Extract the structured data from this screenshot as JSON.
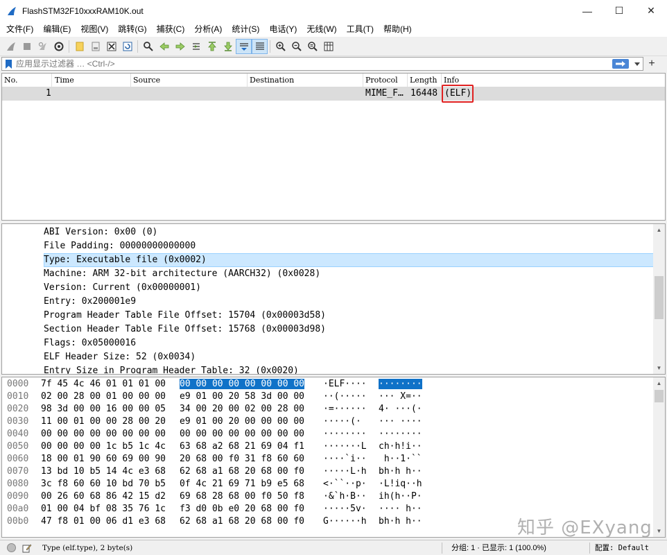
{
  "window": {
    "title": "FlashSTM32F10xxxRAM10K.out",
    "minimize": "—",
    "maximize": "☐",
    "close": "✕"
  },
  "menu": [
    "文件(F)",
    "编辑(E)",
    "视图(V)",
    "跳转(G)",
    "捕获(C)",
    "分析(A)",
    "统计(S)",
    "电话(Y)",
    "无线(W)",
    "工具(T)",
    "帮助(H)"
  ],
  "filter": {
    "placeholder": "应用显示过滤器 … <Ctrl-/>"
  },
  "packet_list": {
    "columns": [
      "No.",
      "Time",
      "Source",
      "Destination",
      "Protocol",
      "Length",
      "Info"
    ],
    "rows": [
      {
        "no": "1",
        "time": "",
        "source": "",
        "destination": "",
        "protocol": "MIME_F…",
        "length": "16448",
        "info": "(ELF)"
      }
    ]
  },
  "details": {
    "lines": [
      "ABI Version: 0x00 (0)",
      "File Padding: 00000000000000",
      "Type: Executable file (0x0002)",
      "Machine: ARM 32-bit architecture (AARCH32) (0x0028)",
      "Version: Current (0x00000001)",
      "Entry: 0x200001e9",
      "Program Header Table File Offset: 15704 (0x00003d58)",
      "Section Header Table File Offset: 15768 (0x00003d98)",
      "Flags: 0x05000016",
      "ELF Header Size: 52 (0x0034)",
      "Entry Size in Program Header Table: 32 (0x0020)"
    ],
    "selected_index": 2
  },
  "bytes": {
    "rows": [
      {
        "offset": "0000",
        "hex1": "7f 45 4c 46 01 01 01 00",
        "hex2": "00 00 00 00 00 00 00 00",
        "ascii1": "·ELF····",
        "ascii2": "········"
      },
      {
        "offset": "0010",
        "hex1": "02 00 28 00 01 00 00 00",
        "hex2": "e9 01 00 20 58 3d 00 00",
        "ascii1": "··(·····",
        "ascii2": "··· X=··"
      },
      {
        "offset": "0020",
        "hex1": "98 3d 00 00 16 00 00 05",
        "hex2": "34 00 20 00 02 00 28 00",
        "ascii1": "·=······",
        "ascii2": "4· ···(·"
      },
      {
        "offset": "0030",
        "hex1": "11 00 01 00 00 28 00 20",
        "hex2": "e9 01 00 20 00 00 00 00",
        "ascii1": "·····(· ",
        "ascii2": "··· ····"
      },
      {
        "offset": "0040",
        "hex1": "00 00 00 00 00 00 00 00",
        "hex2": "00 00 00 00 00 00 00 00",
        "ascii1": "········",
        "ascii2": "········"
      },
      {
        "offset": "0050",
        "hex1": "00 00 00 00 1c b5 1c 4c",
        "hex2": "63 68 a2 68 21 69 04 f1",
        "ascii1": "·······L",
        "ascii2": "ch·h!i··"
      },
      {
        "offset": "0060",
        "hex1": "18 00 01 90 60 69 00 90",
        "hex2": "20 68 00 f0 31 f8 60 60",
        "ascii1": "····`i··",
        "ascii2": " h··1·``"
      },
      {
        "offset": "0070",
        "hex1": "13 bd 10 b5 14 4c e3 68",
        "hex2": "62 68 a1 68 20 68 00 f0",
        "ascii1": "·····L·h",
        "ascii2": "bh·h h··"
      },
      {
        "offset": "0080",
        "hex1": "3c f8 60 60 10 bd 70 b5",
        "hex2": "0f 4c 21 69 71 b9 e5 68",
        "ascii1": "<·``··p·",
        "ascii2": "·L!iq··h"
      },
      {
        "offset": "0090",
        "hex1": "00 26 60 68 86 42 15 d2",
        "hex2": "69 68 28 68 00 f0 50 f8",
        "ascii1": "·&`h·B··",
        "ascii2": "ih(h··P·"
      },
      {
        "offset": "00a0",
        "hex1": "01 00 04 bf 08 35 76 1c",
        "hex2": "f3 d0 0b e0 20 68 00 f0",
        "ascii1": "·····5v·",
        "ascii2": "···· h··"
      },
      {
        "offset": "00b0",
        "hex1": "47 f8 01 00 06 d1 e3 68",
        "hex2": "62 68 a1 68 20 68 00 f0",
        "ascii1": "G······h",
        "ascii2": "bh·h h··"
      }
    ]
  },
  "watermark": "知乎 @EXyang",
  "status": {
    "field_info": "Type (elf.type), 2 byte(s)",
    "packets": "分组: 1 · 已显示: 1 (100.0%)",
    "profile": "配置: Default"
  },
  "colors": {
    "selection": "#1072c8",
    "detail_selection": "#cce8ff",
    "row_bg": "#dcdcdc",
    "highlight_box": "#e02020"
  }
}
